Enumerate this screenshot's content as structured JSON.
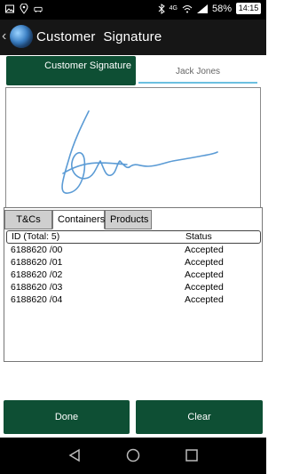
{
  "status_bar": {
    "network": "4G",
    "battery": "58%",
    "time": "14:15",
    "icons": [
      "photo-icon",
      "location-icon",
      "car-icon",
      "bluetooth-icon",
      "wifi-icon",
      "signal-icon",
      "battery-icon"
    ]
  },
  "app_bar": {
    "title": "Customer  Signature",
    "icons": [
      "back-icon",
      "globe-logo-icon"
    ]
  },
  "signature": {
    "tab_label": "Customer Signature",
    "signer_name": "Jack Jones",
    "stroke_color": "#5b9bd5"
  },
  "tabs": [
    {
      "label": "T&Cs",
      "active": false
    },
    {
      "label": "Containers",
      "active": true
    },
    {
      "label": "Products",
      "active": false
    }
  ],
  "list": {
    "headers": {
      "id": "ID (Total: 5)",
      "status": "Status"
    },
    "rows": [
      {
        "id": "6188620 /00",
        "status": "Accepted"
      },
      {
        "id": "6188620 /01",
        "status": "Accepted"
      },
      {
        "id": "6188620 /02",
        "status": "Accepted"
      },
      {
        "id": "6188620 /03",
        "status": "Accepted"
      },
      {
        "id": "6188620 /04",
        "status": "Accepted"
      }
    ]
  },
  "buttons": {
    "done": "Done",
    "clear": "Clear"
  },
  "colors": {
    "primary": "#0e4f34",
    "accent": "#6cc0e0"
  }
}
